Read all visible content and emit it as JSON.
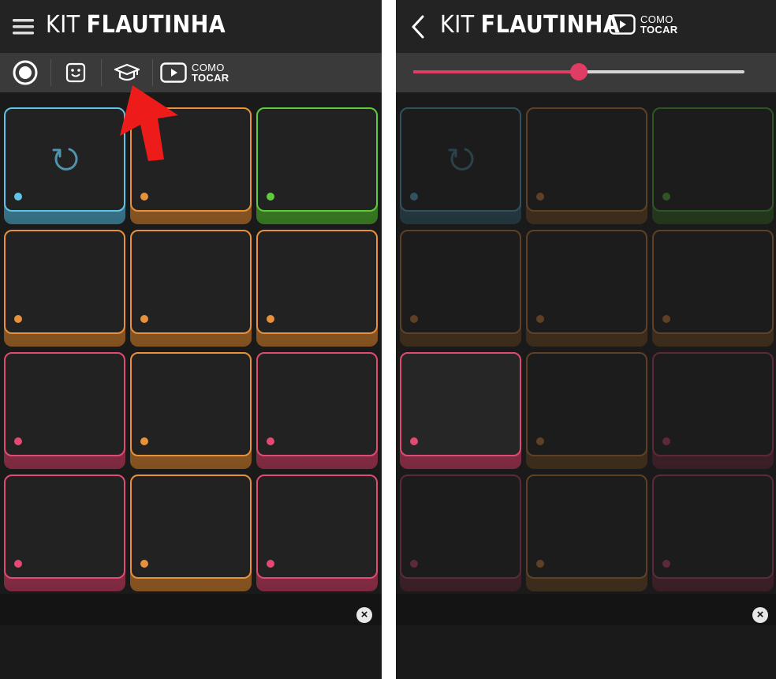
{
  "app": {
    "title_light": "KIT",
    "title_bold": "FLAUTINHA"
  },
  "how_to_play": {
    "line1": "COMO",
    "line2": "TOCAR"
  },
  "close_label": "×",
  "colors": {
    "blue": "#5fc4e8",
    "orange": "#e8913a",
    "green": "#5ecb3a",
    "pink": "#e04a73",
    "slider": "#e03d64"
  },
  "left_screen": {
    "icons": [
      "hamburger-menu-icon",
      "record-icon",
      "emoji-icon",
      "graduation-cap-icon",
      "play-video-icon"
    ],
    "annotation": "red-arrow-pointer",
    "pads": [
      "blue",
      "orange",
      "green",
      "orange",
      "orange",
      "orange",
      "pink",
      "orange",
      "pink",
      "pink",
      "orange",
      "pink"
    ],
    "loop_pad_index": 0
  },
  "right_screen": {
    "icons": [
      "back-chevron-icon",
      "play-video-icon"
    ],
    "slider_value": 0.5,
    "pads": [
      "blue",
      "orange",
      "green",
      "orange",
      "orange",
      "orange",
      "pink",
      "orange",
      "pink",
      "pink",
      "orange",
      "pink"
    ],
    "active_pad_index": 6,
    "loop_pad_index": 0
  }
}
